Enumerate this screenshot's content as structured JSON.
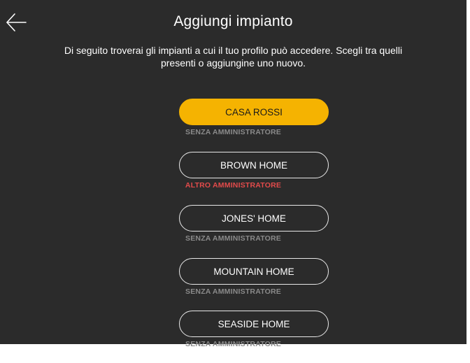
{
  "header": {
    "back_icon": "arrow-left-icon",
    "title": "Aggiungi impianto",
    "subtitle_line1": "Di seguito troverai gli impianti a cui il tuo profilo può accedere. Scegli tra quelli",
    "subtitle_line2": "presenti o aggiungine uno nuovo."
  },
  "colors": {
    "background": "#2b2b2b",
    "accent": "#f5b301",
    "status_neutral": "#8a8a8a",
    "status_alert": "#e34b4b"
  },
  "plants": [
    {
      "name": "CASA ROSSI",
      "status": "SENZA AMMINISTRATORE",
      "selected": true
    },
    {
      "name": "BROWN HOME",
      "status": "ALTRO AMMINISTRATORE",
      "selected": false
    },
    {
      "name": "JONES' HOME",
      "status": "SENZA AMMINISTRATORE",
      "selected": false
    },
    {
      "name": "MOUNTAIN HOME",
      "status": "SENZA AMMINISTRATORE",
      "selected": false
    },
    {
      "name": "SEASIDE HOME",
      "status": "SENZA AMMINISTRATORE",
      "selected": false
    }
  ]
}
